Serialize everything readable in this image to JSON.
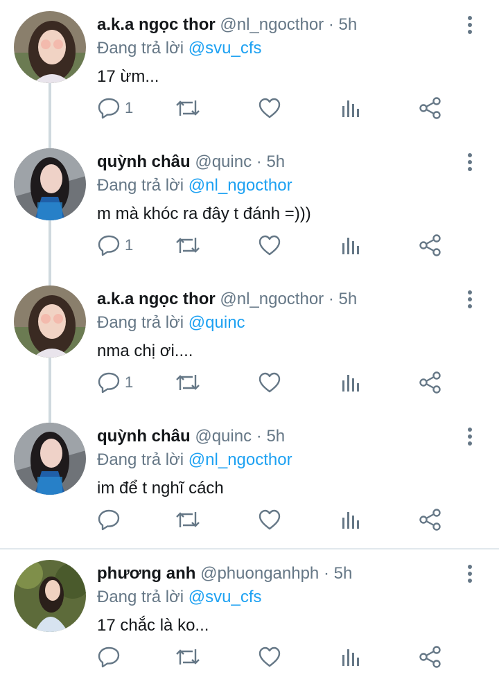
{
  "tweets": [
    {
      "name": "a.k.a ngọc thor",
      "handle": "@nl_ngocthor",
      "time": "5h",
      "reply_prefix": "Đang trả lời",
      "reply_to": "@svu_cfs",
      "text": "17 ừm...",
      "reply_count": "1",
      "avatar": "avatar-ngocthor"
    },
    {
      "name": "quỳnh châu",
      "handle": "@quinc",
      "time": "5h",
      "reply_prefix": "Đang trả lời",
      "reply_to": "@nl_ngocthor",
      "text": "m mà khóc ra đây t đánh =)))",
      "reply_count": "1",
      "avatar": "avatar-quinc"
    },
    {
      "name": "a.k.a ngọc thor",
      "handle": "@nl_ngocthor",
      "time": "5h",
      "reply_prefix": "Đang trả lời",
      "reply_to": "@quinc",
      "text": "nma chị ơi....",
      "reply_count": "1",
      "avatar": "avatar-ngocthor"
    },
    {
      "name": "quỳnh châu",
      "handle": "@quinc",
      "time": "5h",
      "reply_prefix": "Đang trả lời",
      "reply_to": "@nl_ngocthor",
      "text": "im để t nghĩ cách",
      "reply_count": "",
      "avatar": "avatar-quinc"
    },
    {
      "name": "phương anh",
      "handle": "@phuonganhph",
      "time": "5h",
      "reply_prefix": "Đang trả lời",
      "reply_to": "@svu_cfs",
      "text": "17 chắc là ko...",
      "reply_count": "",
      "avatar": "avatar-phuonganh"
    }
  ],
  "separator": "·",
  "icons": [
    "more-vertical-icon",
    "reply-icon",
    "retweet-icon",
    "like-icon",
    "analytics-icon",
    "share-icon"
  ],
  "colors": {
    "mention": "#1da1f2",
    "muted": "#657786",
    "thread_line": "#cfd9de",
    "divider": "#e1e8ed"
  }
}
